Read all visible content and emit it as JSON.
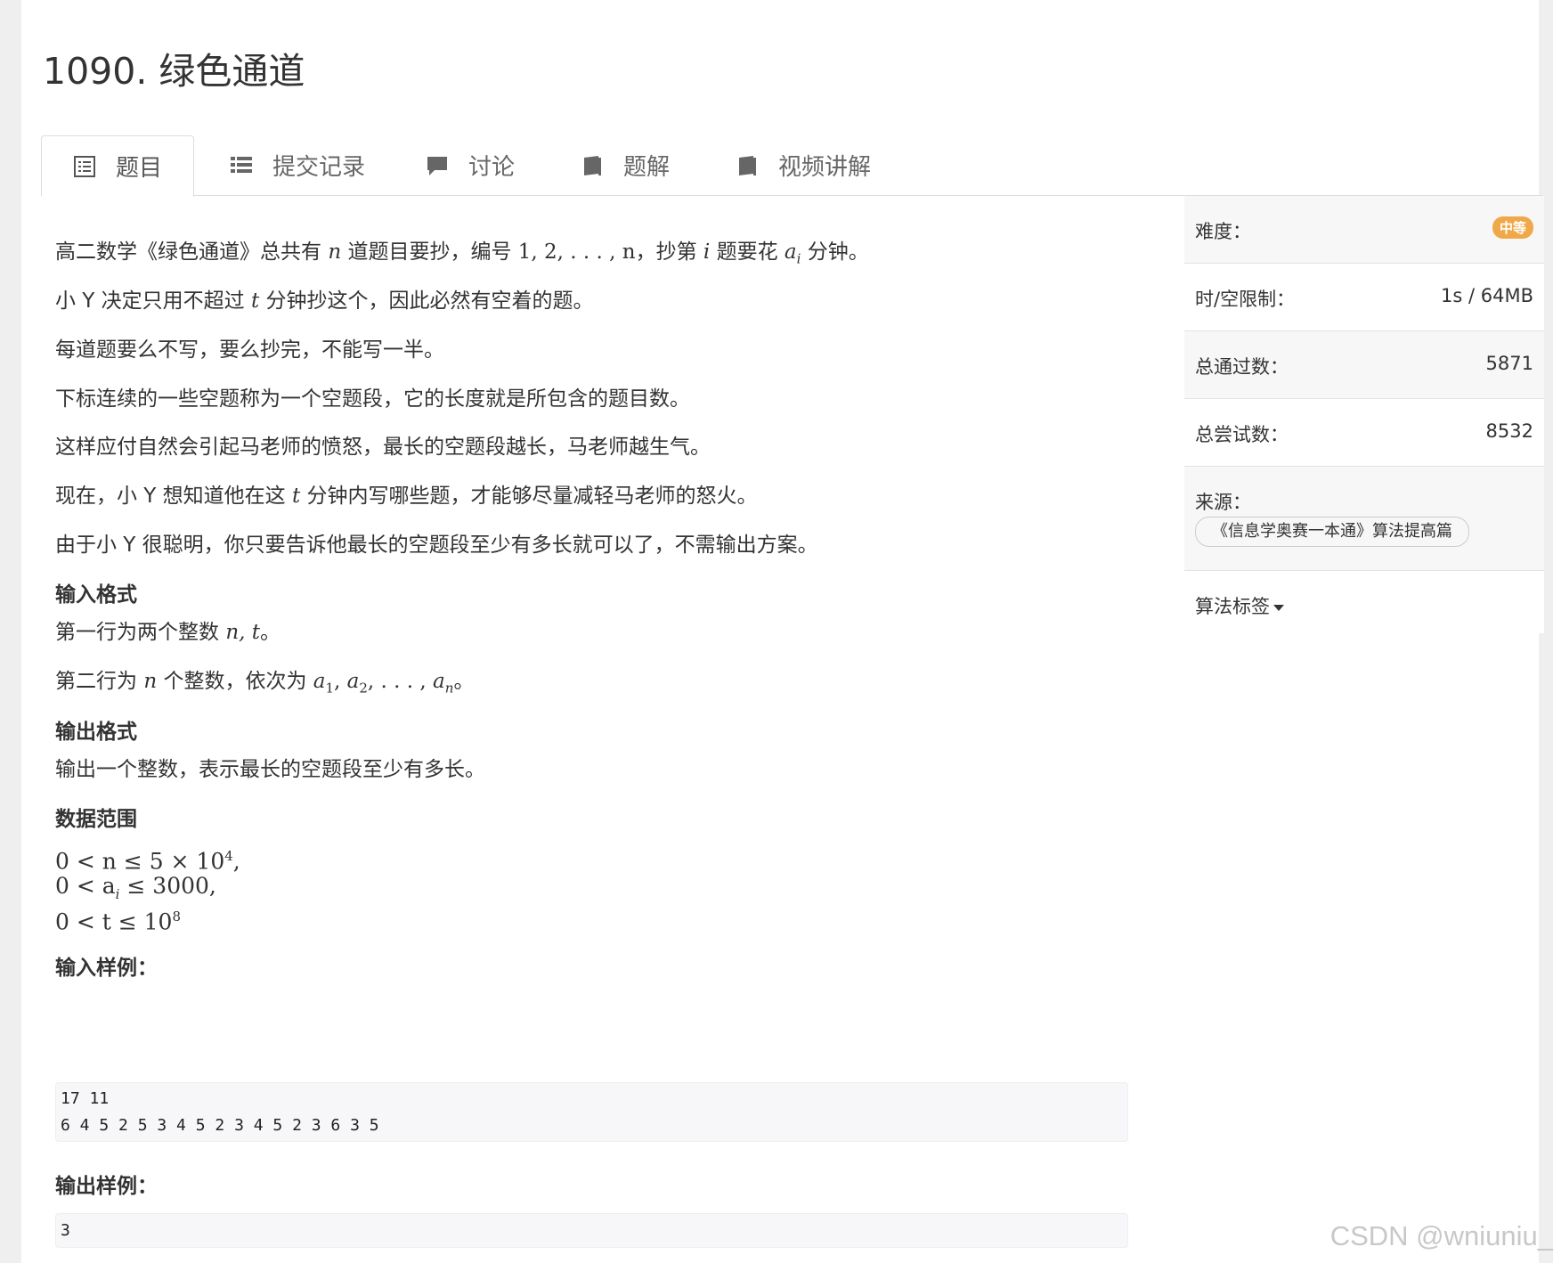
{
  "problem": {
    "title": "1090. 绿色通道"
  },
  "tabs": [
    {
      "label": "题目",
      "icon": "list-doc-icon"
    },
    {
      "label": "提交记录",
      "icon": "list-icon"
    },
    {
      "label": "讨论",
      "icon": "comment-icon"
    },
    {
      "label": "题解",
      "icon": "book-icon"
    },
    {
      "label": "视频讲解",
      "icon": "book-icon"
    }
  ],
  "statement": {
    "p1a": "高二数学《绿色通道》总共有",
    "p1n": "n",
    "p1b": "道题目要抄，编号",
    "p1seq": "1, 2, . . . , n",
    "p1c": "，抄第",
    "p1i": "i",
    "p1d": "题要花",
    "p1ai": "a",
    "p1ai_sub": "i",
    "p1e": "分钟。",
    "p2a": "小 Y 决定只用不超过",
    "p2t": "t",
    "p2b": "分钟抄这个，因此必然有空着的题。",
    "p3": "每道题要么不写，要么抄完，不能写一半。",
    "p4": "下标连续的一些空题称为一个空题段，它的长度就是所包含的题目数。",
    "p5": "这样应付自然会引起马老师的愤怒，最长的空题段越长，马老师越生气。",
    "p6a": "现在，小 Y 想知道他在这",
    "p6t": "t",
    "p6b": "分钟内写哪些题，才能够尽量减轻马老师的怒火。",
    "p7": "由于小 Y 很聪明，你只要告诉他最长的空题段至少有多长就可以了，不需输出方案。"
  },
  "input_format": {
    "heading": "输入格式",
    "l1a": "第一行为两个整数",
    "l1m": "n, t",
    "l1b": "。",
    "l2a": "第二行为",
    "l2n": "n",
    "l2b": "个整数，依次为",
    "l2m": "a",
    "l2rest": "。"
  },
  "output_format": {
    "heading": "输出格式",
    "text": "输出一个整数，表示最长的空题段至少有多长。"
  },
  "range": {
    "heading": "数据范围",
    "r1": "0 < n ≤ 5 × 10",
    "r1sup": "4",
    "r1end": ",",
    "r2": "0 < a",
    "r2sub": "i",
    "r2end": " ≤ 3000,",
    "r3": "0 < t ≤ 10",
    "r3sup": "8"
  },
  "sample_input": {
    "heading": "输入样例：",
    "line1": "17 11",
    "line2": "6 4 5 2 5 3 4 5 2 3 4 5 2 3 6 3 5"
  },
  "sample_output": {
    "heading": "输出样例：",
    "line1": "3"
  },
  "sidebar": {
    "difficulty_label": "难度：",
    "difficulty_value": "中等",
    "limit_label": "时/空限制：",
    "limit_value": "1s / 64MB",
    "passed_label": "总通过数：",
    "passed_value": "5871",
    "tried_label": "总尝试数：",
    "tried_value": "8532",
    "source_label": "来源：",
    "source_value": "《信息学奥赛一本通》算法提高篇",
    "tags_label": "算法标签"
  },
  "watermark": "CSDN @wniuniu_",
  "colors": {
    "badge": "#f0a94a",
    "code_bg": "#f7f7f9",
    "sidebar_bg": "#f7f7f7"
  }
}
